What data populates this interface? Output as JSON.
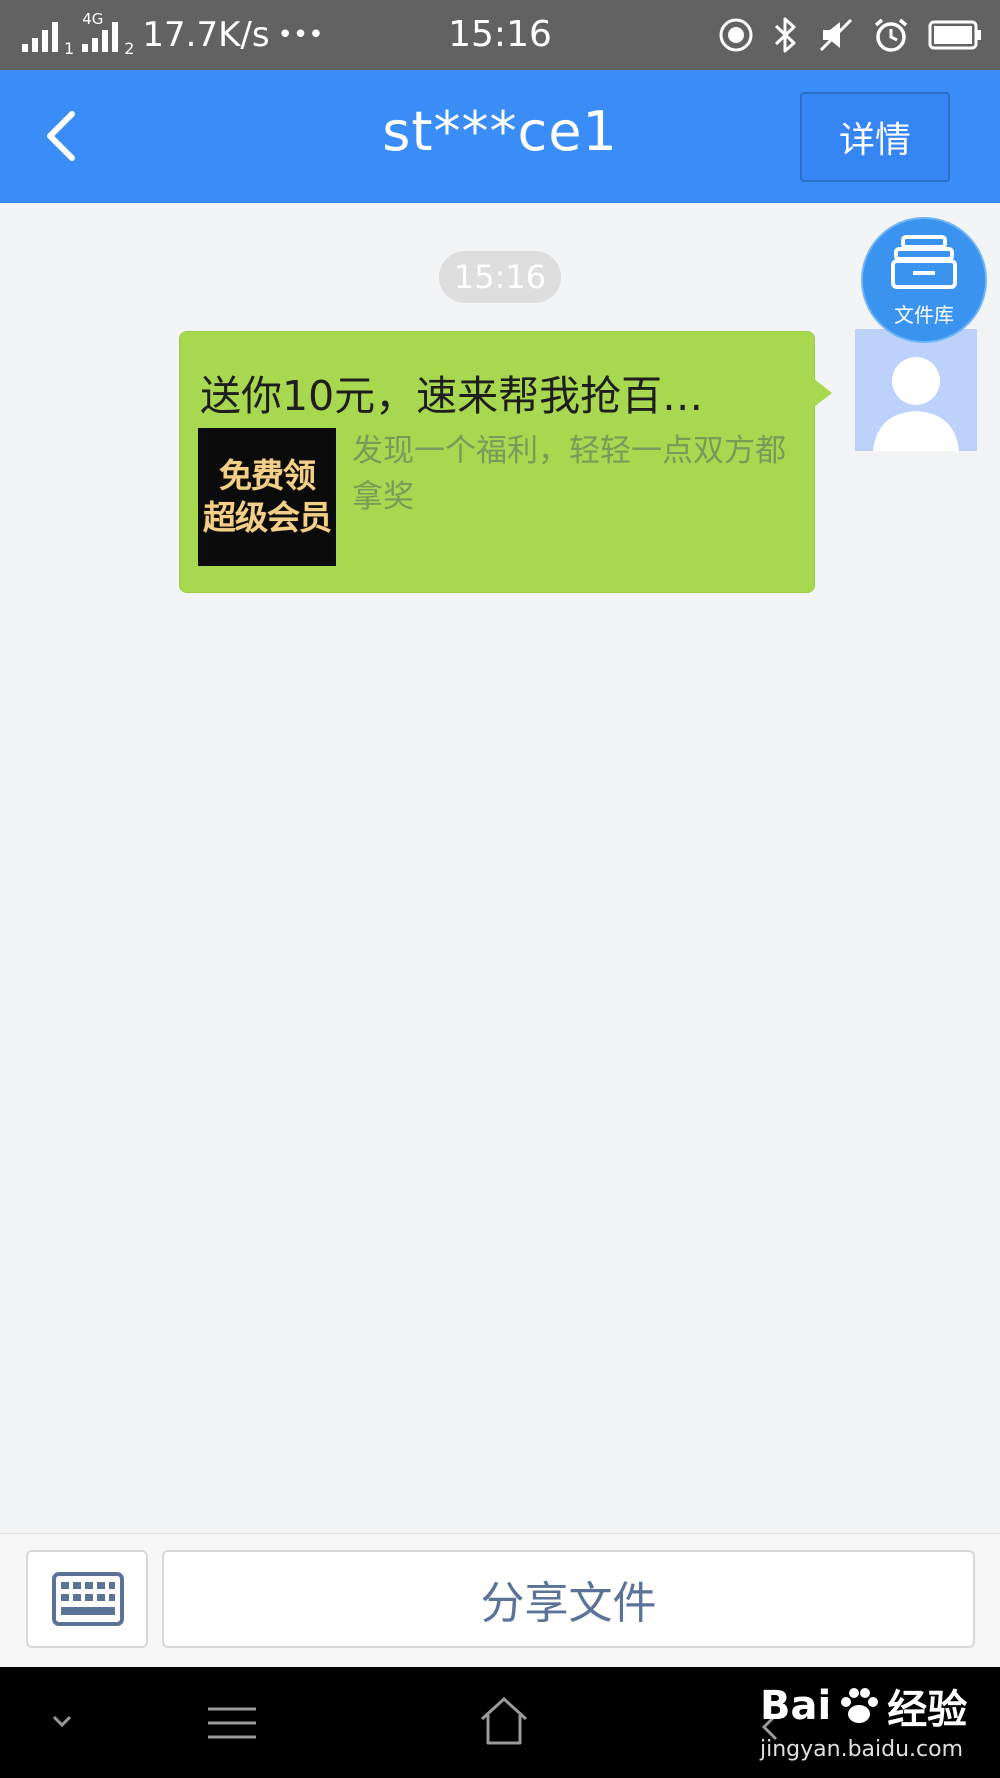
{
  "status_bar": {
    "network_type": "4G",
    "sim1": "1",
    "sim2": "2",
    "speed": "17.7K/s",
    "more": "•••",
    "time": "15:16"
  },
  "app_bar": {
    "title": "st***ce1",
    "detail_label": "详情"
  },
  "chat": {
    "timestamp": "15:16",
    "message": {
      "title": "送你10元，速来帮我抢百…",
      "thumb_line1": "免费领",
      "thumb_line2": "超级会员",
      "description": "发现一个福利，轻轻一点双方都拿奖"
    },
    "file_library_label": "文件库"
  },
  "bottom_bar": {
    "share_label": "分享文件"
  },
  "watermark": {
    "brand_a": "Bai",
    "brand_b": "经验",
    "url": "jingyan.baidu.com"
  },
  "colors": {
    "app_bar": "#3a8cf7",
    "bubble": "#a8d84f",
    "status_bar": "#626262"
  }
}
